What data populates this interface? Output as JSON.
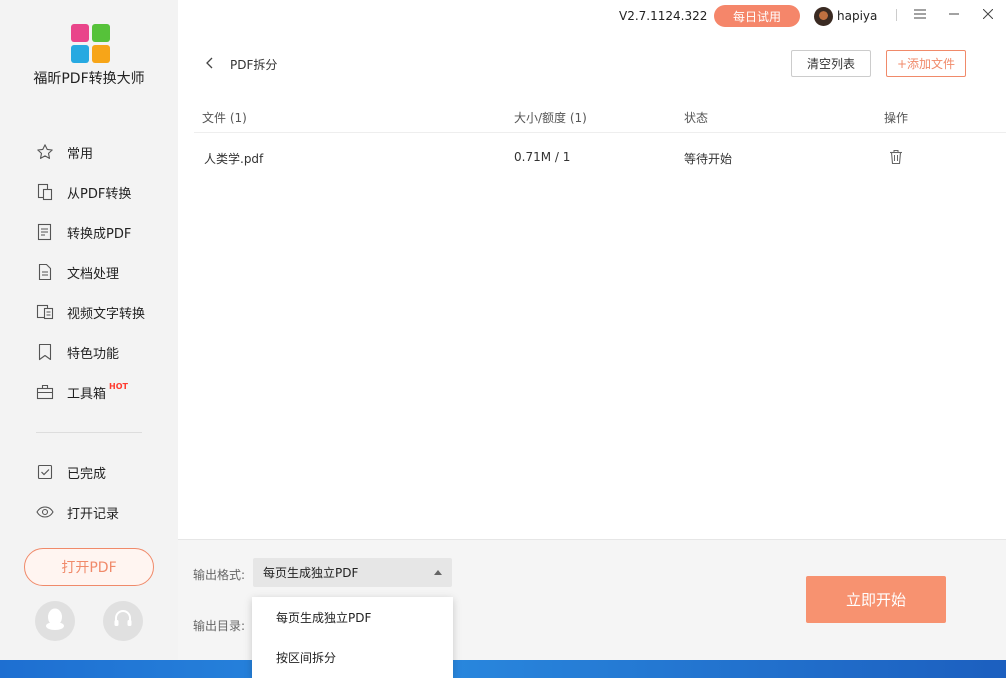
{
  "app": {
    "name": "福昕PDF转换大师",
    "version": "V2.7.1124.322",
    "trial_label": "每日试用",
    "username": "hapiya",
    "logo_colors": [
      "#e9458a",
      "#56c23a",
      "#27a9e1",
      "#f7a518"
    ]
  },
  "sidebar": {
    "items": [
      {
        "label": "常用",
        "icon": "star-icon"
      },
      {
        "label": "从PDF转换",
        "icon": "pdf-convert-icon"
      },
      {
        "label": "转换成PDF",
        "icon": "to-pdf-icon"
      },
      {
        "label": "文档处理",
        "icon": "document-icon"
      },
      {
        "label": "视频文字转换",
        "icon": "video-text-icon"
      },
      {
        "label": "特色功能",
        "icon": "bookmark-icon"
      },
      {
        "label": "工具箱",
        "icon": "toolbox-icon",
        "badge": "HOT"
      },
      {
        "label": "已完成",
        "icon": "check-box-icon"
      },
      {
        "label": "打开记录",
        "icon": "eye-icon"
      }
    ],
    "open_pdf_label": "打开PDF"
  },
  "header": {
    "title": "PDF拆分",
    "clear_label": "清空列表",
    "add_label": "+添加文件"
  },
  "table": {
    "columns": [
      "文件 (1)",
      "大小/额度 (1)",
      "状态",
      "操作"
    ],
    "rows": [
      {
        "name": "人类学.pdf",
        "size": "0.71M / 1",
        "status": "等待开始"
      }
    ]
  },
  "output": {
    "format_label": "输出格式:",
    "format_value": "每页生成独立PDF",
    "dir_label": "输出目录:",
    "options": [
      "每页生成独立PDF",
      "按区间拆分"
    ]
  },
  "start_label": "立即开始",
  "colors": {
    "accent": "#f5866a",
    "sidebar_bg": "#f3f3f3"
  }
}
